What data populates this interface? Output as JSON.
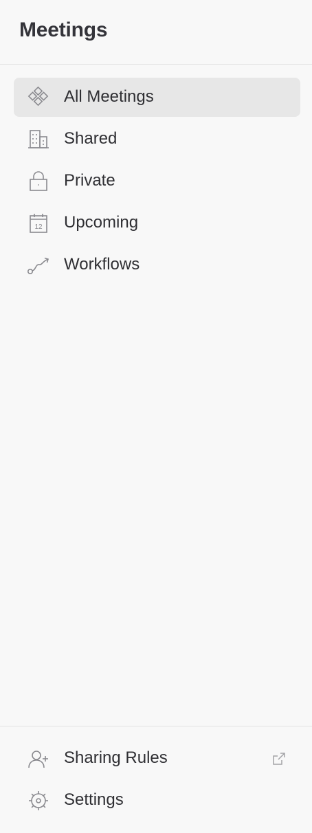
{
  "header": {
    "title": "Meetings"
  },
  "nav": {
    "items": [
      {
        "label": "All Meetings",
        "icon": "all-meetings-icon",
        "active": true
      },
      {
        "label": "Shared",
        "icon": "building-icon",
        "active": false
      },
      {
        "label": "Private",
        "icon": "lock-icon",
        "active": false
      },
      {
        "label": "Upcoming",
        "icon": "calendar-icon",
        "active": false
      },
      {
        "label": "Workflows",
        "icon": "workflow-icon",
        "active": false
      }
    ]
  },
  "footer": {
    "items": [
      {
        "label": "Sharing Rules",
        "icon": "add-user-icon",
        "external": true,
        "external_icon": "external-link-icon"
      },
      {
        "label": "Settings",
        "icon": "gear-icon"
      }
    ]
  },
  "colors": {
    "background": "#f8f8f8",
    "active_background": "#e7e7e7",
    "text": "#2f2f33",
    "icon": "#8a8a8f",
    "divider": "#e2e2e2"
  }
}
